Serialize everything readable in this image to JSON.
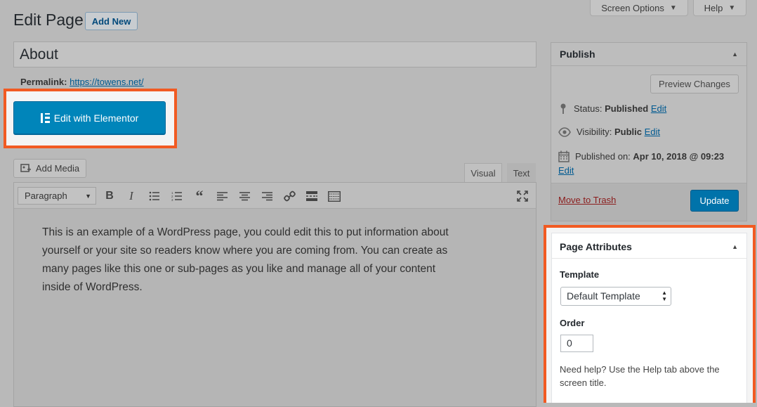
{
  "screen_meta": {
    "screen_options_label": "Screen Options",
    "help_label": "Help"
  },
  "header": {
    "title": "Edit Page",
    "add_new_label": "Add New"
  },
  "post": {
    "title": "About",
    "permalink_label": "Permalink:",
    "permalink_url": "https://towens.net/"
  },
  "elementor": {
    "button_label": "Edit with Elementor"
  },
  "editor": {
    "add_media_label": "Add Media",
    "tab_visual": "Visual",
    "tab_text": "Text",
    "format_select_value": "Paragraph",
    "toolbar_icons": [
      "bold-icon",
      "italic-icon",
      "bullet-list-icon",
      "numbered-list-icon",
      "blockquote-icon",
      "align-left-icon",
      "align-center-icon",
      "align-right-icon",
      "link-icon",
      "read-more-icon",
      "toolbar-toggle-icon",
      "fullscreen-icon"
    ],
    "content": "This is an example of a WordPress page, you could edit this to put information about yourself or your site so readers know where you are coming from. You can create as many pages like this one or sub-pages as you like and manage all of your content inside of WordPress."
  },
  "publish": {
    "title": "Publish",
    "preview_label": "Preview Changes",
    "status_label": "Status:",
    "status_value": "Published",
    "visibility_label": "Visibility:",
    "visibility_value": "Public",
    "published_label": "Published on:",
    "published_value": "Apr 10, 2018 @ 09:23",
    "edit_label": "Edit",
    "trash_label": "Move to Trash",
    "update_label": "Update"
  },
  "page_attributes": {
    "title": "Page Attributes",
    "template_label": "Template",
    "template_value": "Default Template",
    "order_label": "Order",
    "order_value": "0",
    "help_text": "Need help? Use the Help tab above the screen title."
  },
  "colors": {
    "highlight": "#f15a22",
    "primary_button": "#0085ba",
    "link": "#005a91"
  }
}
